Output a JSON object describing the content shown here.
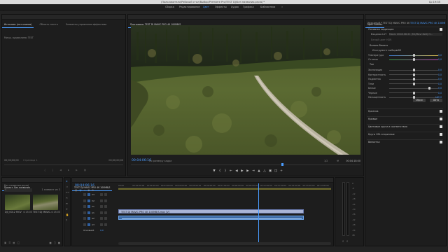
{
  "menubar": {
    "apple": "",
    "app_name": "Premiere Pro CC",
    "items": [
      "Файл",
      "Изменить",
      "Клип",
      "Эпизод",
      "Маркеры",
      "Графика",
      "Окно",
      "Справка"
    ],
    "window_title": "/Пользователи/Рабочий стол/Выбор/Premiere Pro/TEST DJ/Без названия.prproj *",
    "status": "Ср 19:35"
  },
  "workspace": {
    "tabs": [
      "Сборка",
      "Редактирование",
      "Цвет",
      "Эффекты",
      "Аудио",
      "Графика",
      "Библиотеки"
    ],
    "active_index": 2
  },
  "source_panel": {
    "tabs": [
      "Источник: (нет клипов)",
      "Область текста",
      "Элементы управления эффектами",
      "Микш. аудиоклипа: TEST"
    ],
    "active_tab": 0,
    "timecode_left": "00;00;00;00",
    "timecode_right": "00;00;00;00",
    "page_label": "Страница 1"
  },
  "program_panel": {
    "tab_label": "Программа: TEST DJ MAVIC PRO 4K 100MB/S",
    "timecode": "00:04:06:16",
    "fit_label": "По размеру кадра",
    "quality": "1/2",
    "duration": "00:04:18:00"
  },
  "lumetri": {
    "tab_label": "Цвет Lumetri",
    "source_label": "Исходный * TEST DJ MAVIC PRO 4K 100MB/S",
    "clip_label": "TEST DJ MAVIC PRO 4K 100MB/S",
    "section_basic": "Основная коррекция",
    "lut_label": "Входная LUT",
    "lut_value": "Mavic 2018-06-21 (Mr/Mavi 8x8) O...",
    "hdr_label": "Белый цвет HDR",
    "wb_section": "Баланс белого",
    "wb_picker": "Инструмент выбора ББ",
    "temperature_label": "Температура",
    "temperature_value": "0,0",
    "tint_label": "Оттенок",
    "tint_value": "0,0",
    "tone_section": "Тон",
    "sliders": [
      {
        "label": "Экспозиция",
        "value": "0,0",
        "pos": 0.5
      },
      {
        "label": "Контрастность",
        "value": "0,0",
        "pos": 0.5
      },
      {
        "label": "Подсветка",
        "value": "0,0",
        "pos": 0.5
      },
      {
        "label": "Тени",
        "value": "0,0",
        "pos": 0.5
      },
      {
        "label": "Белые",
        "value": "0,0",
        "pos": 0.82
      },
      {
        "label": "Черные",
        "value": "0,0",
        "pos": 0.5
      },
      {
        "label": "Насыщенность",
        "value": "100,0",
        "pos": 0.5
      }
    ],
    "reset_button": "Сброс",
    "auto_button": "Авто",
    "sections": [
      "Креатив",
      "Кривые",
      "Цветовые круги и соответствия",
      "Круги HSL вторичные",
      "Виньетка"
    ]
  },
  "project_panel": {
    "tab_label": "Проект: Без названия",
    "search_placeholder": "",
    "items_count": "1 элемент из 3",
    "bin_label": "Без названия.prproj",
    "clips": [
      {
        "name": "DJI_0012 MOV",
        "duration": "4:18:00"
      },
      {
        "name": "TEST DJ MAVIC...",
        "duration": "4:18:00"
      }
    ]
  },
  "timeline": {
    "tab_label": "TEST DJ MAVIC PRO 4K 100MB/S",
    "timecode": "00:04:06:16",
    "ruler": [
      "00:00",
      "00:01:00:00",
      "00:02:00:00",
      "00:03:00:00",
      "00:04:00:00",
      "00:05:00:00",
      "00:06:00:00",
      "00:07:00:00",
      "00:08:00:00",
      "00:09:00:00",
      "00:10:00:00",
      "00:11:00:00",
      "00:12:00:00",
      "00:13:00:00",
      "00:14:00:00"
    ],
    "video_tracks": [
      "V3",
      "V2",
      "V1"
    ],
    "audio_tracks": [
      "A1",
      "A2",
      "A3"
    ],
    "master_label": "Основной",
    "master_value": "0,0",
    "video_clip_label": "TEST DJ MAVIC PRO 4K 100MB/S.mov [V]",
    "playhead_fraction": 0.655
  },
  "audio_meter": {
    "scale": [
      "0",
      "-6",
      "-12",
      "-18",
      "-24",
      "-30",
      "-36",
      "-42",
      "-48",
      "-54",
      "dB"
    ],
    "solo_labels": [
      "S",
      "S"
    ]
  }
}
